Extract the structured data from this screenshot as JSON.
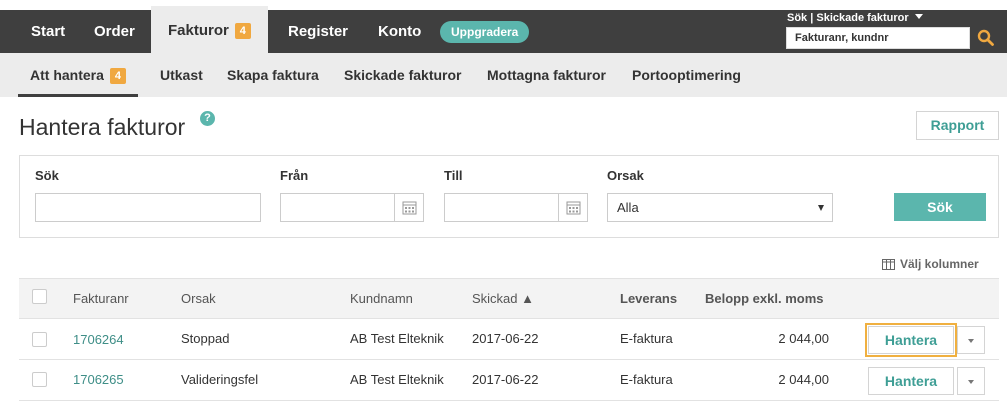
{
  "topnav": {
    "items": [
      {
        "label": "Start"
      },
      {
        "label": "Order"
      },
      {
        "label": "Fakturor",
        "badge": "4",
        "active": true
      },
      {
        "label": "Register"
      },
      {
        "label": "Konto"
      }
    ],
    "upgrade_label": "Uppgradera",
    "search_mode": "Sök | Skickade fakturor",
    "search_value": "Fakturanr, kundnr",
    "search_icon": "search-icon"
  },
  "subnav": {
    "items": [
      {
        "label": "Att hantera",
        "badge": "4",
        "active": true
      },
      {
        "label": "Utkast"
      },
      {
        "label": "Skapa faktura"
      },
      {
        "label": "Skickade fakturor"
      },
      {
        "label": "Mottagna fakturor"
      },
      {
        "label": "Portooptimering"
      }
    ]
  },
  "page": {
    "title": "Hantera fakturor",
    "help": "?",
    "report_label": "Rapport"
  },
  "filter": {
    "search_label": "Sök",
    "from_label": "Från",
    "to_label": "Till",
    "reason_label": "Orsak",
    "reason_value": "Alla",
    "search_button": "Sök"
  },
  "choose_columns": "Välj kolumner",
  "table": {
    "headers": {
      "invoice": "Fakturanr",
      "reason": "Orsak",
      "customer": "Kundnamn",
      "sent": "Skickad ▲",
      "delivery": "Leverans",
      "amount": "Belopp exkl. moms"
    },
    "rows": [
      {
        "invoice": "1706264",
        "reason": "Stoppad",
        "customer": "AB Test Elteknik",
        "sent": "2017-06-22",
        "delivery": "E-faktura",
        "amount": "2 044,00",
        "action": "Hantera"
      },
      {
        "invoice": "1706265",
        "reason": "Valideringsfel",
        "customer": "AB Test Elteknik",
        "sent": "2017-06-22",
        "delivery": "E-faktura",
        "amount": "2 044,00",
        "action": "Hantera"
      }
    ]
  },
  "colors": {
    "nav_bg": "#3f3f3f",
    "subnav_bg": "#ececec",
    "accent": "#5bb6ad",
    "badge": "#f0a840",
    "link": "#3e8e87"
  }
}
